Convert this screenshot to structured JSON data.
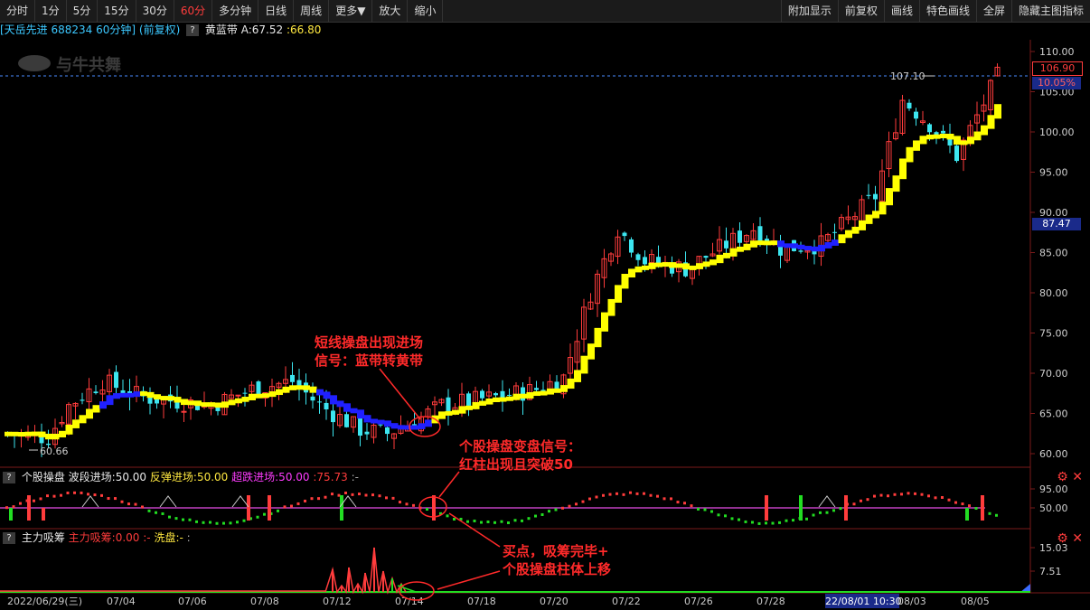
{
  "toolbar": {
    "periods": [
      "分时",
      "1分",
      "5分",
      "15分",
      "30分",
      "60分",
      "多分钟",
      "日线",
      "周线",
      "更多▼",
      "放大",
      "缩小"
    ],
    "active_period": "60分",
    "right": [
      "附加显示",
      "前复权",
      "画线",
      "特色画线",
      "全屏",
      "隐藏主图指标"
    ]
  },
  "info": {
    "title": "[天岳先进 688234 60分钟] (前复权)",
    "indicator": "黄蓝带",
    "a_label": "A:67.52",
    "b_label": ":66.80"
  },
  "watermark": "与牛共舞",
  "price_axis": {
    "ticks": [
      "110.00",
      "105.00",
      "100.00",
      "95.00",
      "90.00",
      "85.00",
      "80.00",
      "75.00",
      "70.00",
      "65.00",
      "60.00"
    ],
    "current_price": "106.90",
    "current_pct": "10.05%",
    "cursor_price": "87.47",
    "high_label": "107.10",
    "low_label": "60.66"
  },
  "pane1": {
    "name": "个股操盘",
    "bo_duan": "波段进场:50.00",
    "fan_tan": "反弹进场:50.00",
    "chao_die": "超跌进场:50.00",
    "value": ":75.73",
    "tail": ":-",
    "ticks": [
      "95.00",
      "50.00"
    ]
  },
  "pane2": {
    "name": "主力吸筹",
    "zhu_li": "主力吸筹:0.00",
    "dash": ":-",
    "xi_pan": "洗盘:-",
    "tail": ":",
    "ticks": [
      "15.03",
      "7.51"
    ]
  },
  "annotations": {
    "a1_line1": "短线操盘出现进场",
    "a1_line2": "信号：蓝带转黄带",
    "a2_line1": "个股操盘变盘信号：",
    "a2_line2": "红柱出现且突破50",
    "a3_line1": "买点，吸筹完毕+",
    "a3_line2": "个股操盘柱体上移"
  },
  "x_axis": {
    "labels": [
      "2022/06/29(三)",
      "07/04",
      "07/06",
      "07/08",
      "07/12",
      "07/14",
      "07/18",
      "07/20",
      "07/22",
      "07/26",
      "07/28",
      "22/08/01 10:30",
      "08/03",
      "08/05"
    ]
  },
  "colors": {
    "up": "#ff3c3c",
    "down": "#3ce6f0",
    "band_yellow": "#ffff00",
    "band_blue": "#2020ff",
    "accent": "#ff3c3c"
  }
}
